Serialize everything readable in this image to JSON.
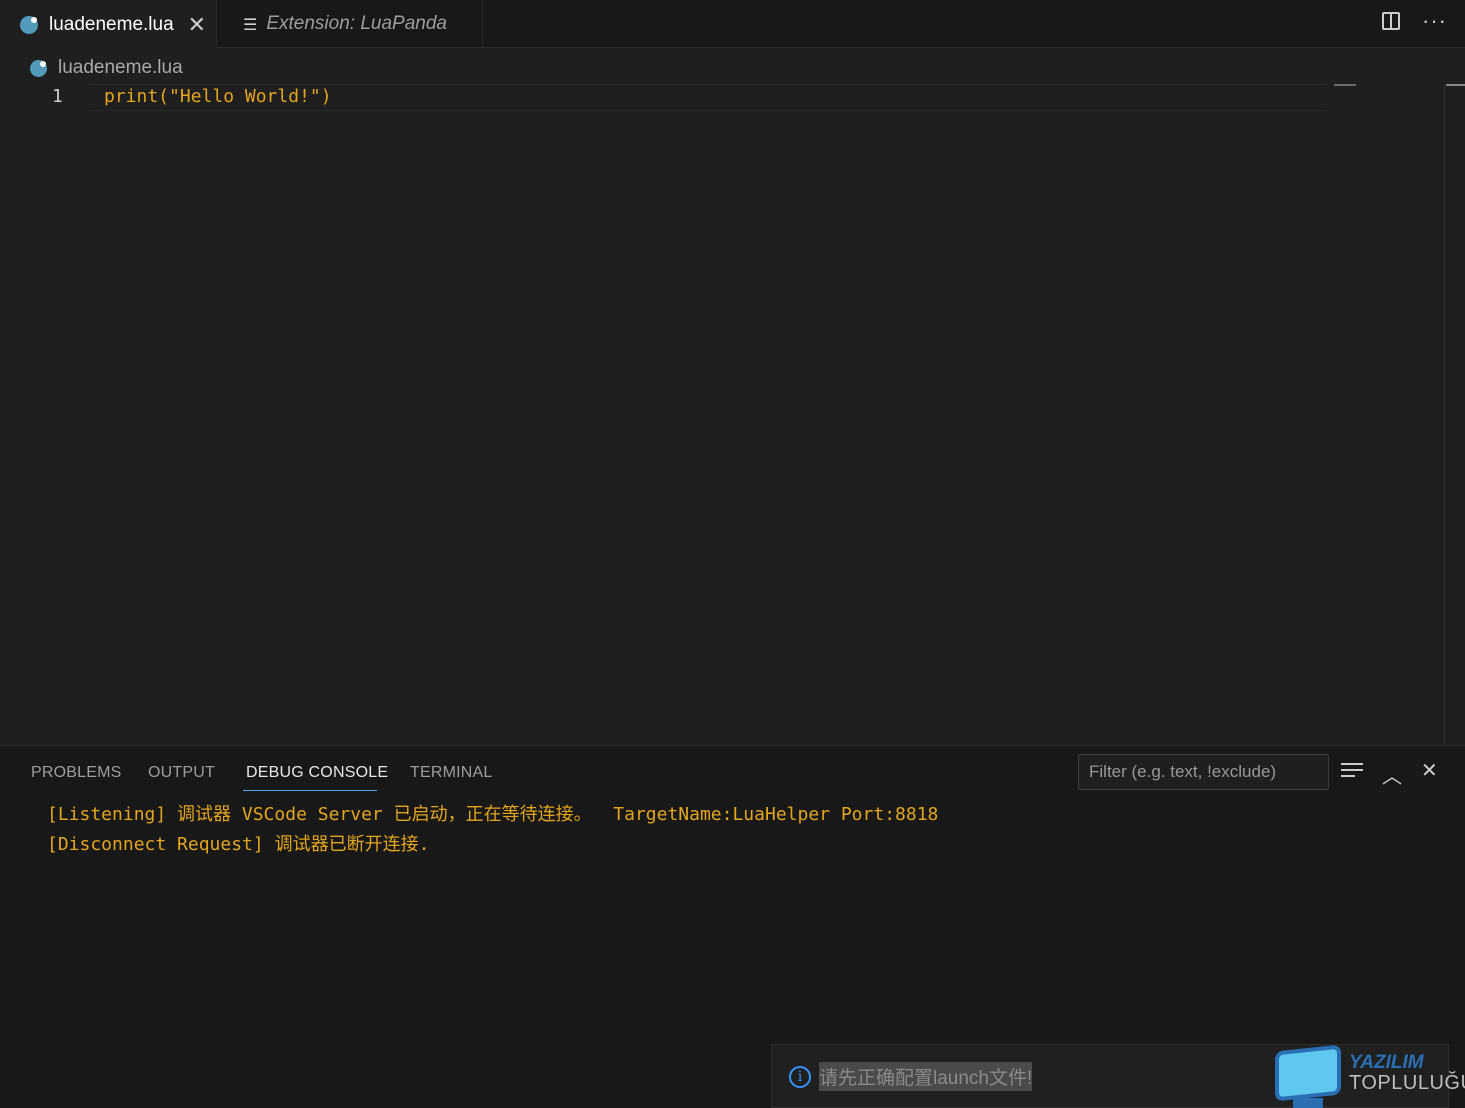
{
  "tabs": {
    "active": {
      "label": "luadeneme.lua",
      "close": "✕"
    },
    "inactive": {
      "label": "Extension: LuaPanda"
    }
  },
  "breadcrumb": {
    "file": "luadeneme.lua"
  },
  "editor": {
    "lines": [
      {
        "number": "1",
        "code": "print(\"Hello World!\")"
      }
    ]
  },
  "panel": {
    "tabs": [
      "PROBLEMS",
      "OUTPUT",
      "DEBUG CONSOLE",
      "TERMINAL"
    ],
    "active_tab": "DEBUG CONSOLE",
    "filter_placeholder": "Filter (e.g. text, !exclude)",
    "console": [
      "[Listening] 调试器 VSCode Server 已启动，正在等待连接。  TargetName:LuaHelper Port:8818",
      "[Disconnect Request] 调试器已断开连接."
    ]
  },
  "notification": {
    "message": "请先正确配置launch文件!"
  },
  "watermark": {
    "line1": "YAZILIM",
    "line2": "TOPLULUĞU"
  },
  "colors": {
    "accent": "#4daafc",
    "string": "#e3a51c",
    "info": "#3794ff"
  }
}
